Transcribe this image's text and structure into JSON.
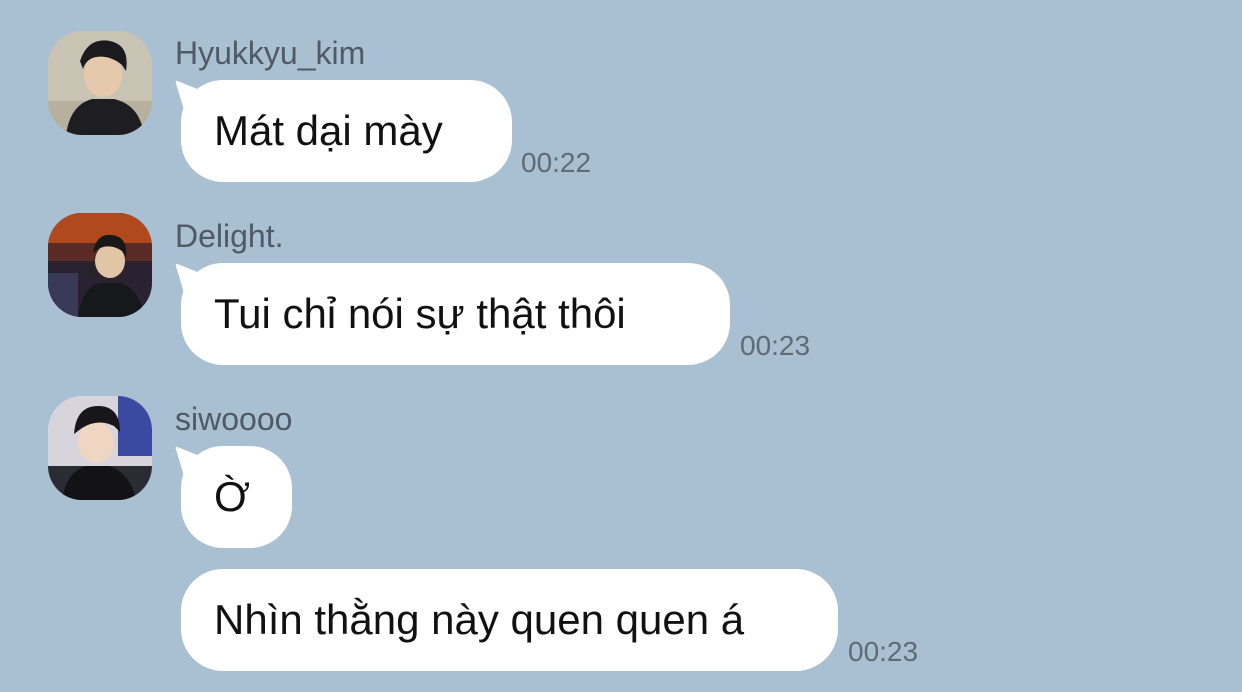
{
  "colors": {
    "background": "#a9bfd2",
    "bubble": "#ffffff",
    "sender_text": "#4f5a66",
    "time_text": "#5e6b78"
  },
  "messages": [
    {
      "sender": "Hyukkyu_kim",
      "avatar_icon": "user-avatar-photo",
      "text": "Mát dại mày",
      "time": "00:22"
    },
    {
      "sender": "Delight.",
      "avatar_icon": "user-avatar-photo",
      "text": "Tui chỉ nói sự thật thôi",
      "time": "00:23"
    },
    {
      "sender": "siwoooo",
      "avatar_icon": "user-avatar-photo",
      "text": "Ờ",
      "time": ""
    },
    {
      "sender": "",
      "avatar_icon": "",
      "text": "Nhìn thằng này quen quen á",
      "time": "00:23"
    }
  ]
}
